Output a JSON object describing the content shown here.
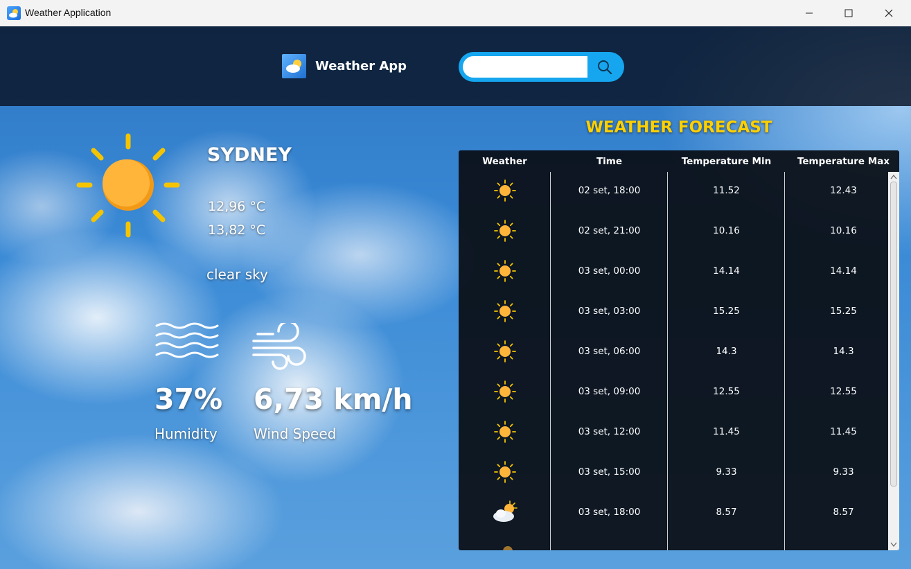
{
  "window": {
    "title": "Weather Application"
  },
  "header": {
    "brand": "Weather App",
    "search_value": ""
  },
  "current": {
    "city": "SYDNEY",
    "temp_min": "12,96 °C",
    "temp_max": "13,82 °C",
    "description": "clear sky",
    "humidity_value": "37%",
    "humidity_label": "Humidity",
    "wind_value": "6,73 km/h",
    "wind_label": "Wind Speed",
    "icon": "sun-icon"
  },
  "forecast": {
    "title": "WEATHER FORECAST",
    "columns": [
      "Weather",
      "Time",
      "Temperature Min",
      "Temperature Max"
    ],
    "rows": [
      {
        "icon": "sun-icon",
        "time": "02 set, 18:00",
        "min": "11.52",
        "max": "12.43"
      },
      {
        "icon": "sun-icon",
        "time": "02 set, 21:00",
        "min": "10.16",
        "max": "10.16"
      },
      {
        "icon": "sun-icon",
        "time": "03 set, 00:00",
        "min": "14.14",
        "max": "14.14"
      },
      {
        "icon": "sun-icon",
        "time": "03 set, 03:00",
        "min": "15.25",
        "max": "15.25"
      },
      {
        "icon": "sun-icon",
        "time": "03 set, 06:00",
        "min": "14.3",
        "max": "14.3"
      },
      {
        "icon": "sun-icon",
        "time": "03 set, 09:00",
        "min": "12.55",
        "max": "12.55"
      },
      {
        "icon": "sun-icon",
        "time": "03 set, 12:00",
        "min": "11.45",
        "max": "11.45"
      },
      {
        "icon": "sun-icon",
        "time": "03 set, 15:00",
        "min": "9.33",
        "max": "9.33"
      },
      {
        "icon": "cloud-sun-icon",
        "time": "03 set, 18:00",
        "min": "8.57",
        "max": "8.57"
      }
    ]
  },
  "colors": {
    "accent": "#ffd000",
    "search": "#15a6ef",
    "sun": "#ffb53a"
  }
}
